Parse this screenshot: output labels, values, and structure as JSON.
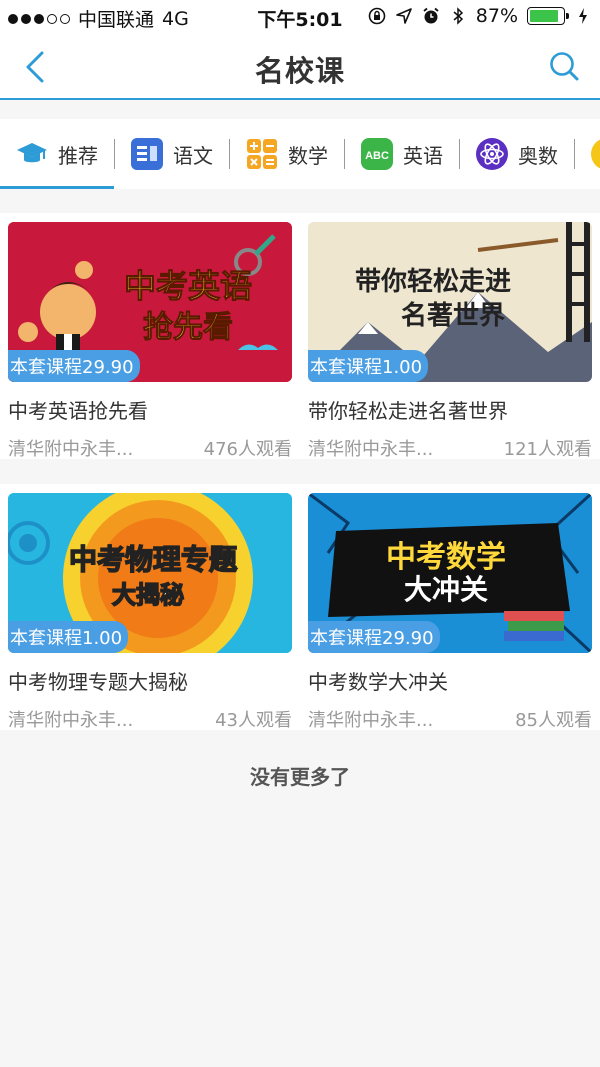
{
  "status_bar": {
    "carrier": "中国联通",
    "network": "4G",
    "time": "下午5:01",
    "battery": "87%",
    "battery_level": 0.87
  },
  "nav": {
    "title": "名校课"
  },
  "categories": [
    {
      "label": "推荐",
      "icon": "graduation-cap-icon",
      "active": true
    },
    {
      "label": "语文",
      "icon": "chinese-book-icon",
      "active": false
    },
    {
      "label": "数学",
      "icon": "math-grid-icon",
      "active": false
    },
    {
      "label": "英语",
      "icon": "abc-icon",
      "active": false
    },
    {
      "label": "奥数",
      "icon": "atom-icon",
      "active": false
    }
  ],
  "courses": [
    {
      "thumb_title_1": "中考英语",
      "thumb_title_2": "抢先看",
      "price": "本套课程29.90",
      "title": "中考英语抢先看",
      "school": "清华附中永丰...",
      "views": "476人观看"
    },
    {
      "thumb_title_1": "带你轻松走进",
      "thumb_title_2": "名著世界",
      "price": "本套课程1.00",
      "title": "带你轻松走进名著世界",
      "school": "清华附中永丰...",
      "views": "121人观看"
    },
    {
      "thumb_title_1": "中考物理专题",
      "thumb_title_2": "大揭秘",
      "price": "本套课程1.00",
      "title": "中考物理专题大揭秘",
      "school": "清华附中永丰...",
      "views": "43人观看"
    },
    {
      "thumb_title_1": "中考数学",
      "thumb_title_2": "大冲关",
      "price": "本套课程29.90",
      "title": "中考数学大冲关",
      "school": "清华附中永丰...",
      "views": "85人观看"
    }
  ],
  "footer": {
    "text": "没有更多了"
  },
  "colors": {
    "accent": "#2d9bd6",
    "badge": "#4a9ee3"
  }
}
